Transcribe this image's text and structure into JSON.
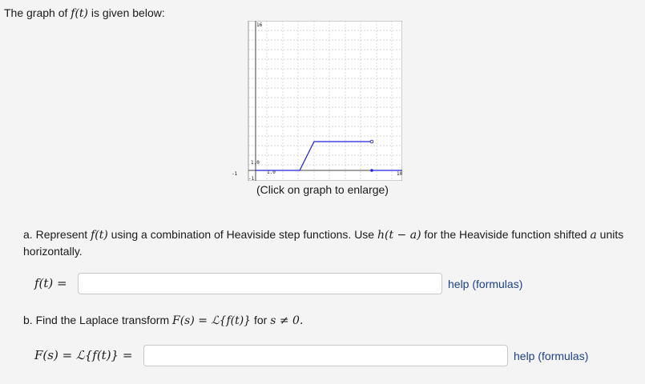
{
  "intro": {
    "prefix": "The graph of ",
    "f_t": "f(t)",
    "suffix": " is given below:"
  },
  "graph": {
    "caption": "(Click on graph to enlarge)",
    "tick_labels": {
      "y_top": "16",
      "y_one": "1.0",
      "x_one": "1.0",
      "x_right": "10",
      "x_left": "-1",
      "y_bottom": "-1"
    }
  },
  "question_a": {
    "letter": "a.",
    "text_1": " Represent ",
    "f_t": "f(t)",
    "text_2": " using a combination of Heaviside step functions. Use ",
    "h_expr": "h(t − a)",
    "text_3": " for the Heaviside function shifted ",
    "a_var": "a",
    "text_4": " units horizontally.",
    "label": "f(t) =",
    "input_value": "",
    "help": "help (formulas)"
  },
  "question_b": {
    "letter": "b.",
    "text_1": " Find the Laplace transform ",
    "expr": "F(s) = ℒ{f(t)}",
    "text_2": " for ",
    "cond": "s ≠ 0.",
    "label": "F(s) = ℒ{f(t)} =",
    "input_value": "",
    "help": "help (formulas)"
  },
  "colors": {
    "graph_line": "#2020e0",
    "link": "#1d3f8a"
  }
}
